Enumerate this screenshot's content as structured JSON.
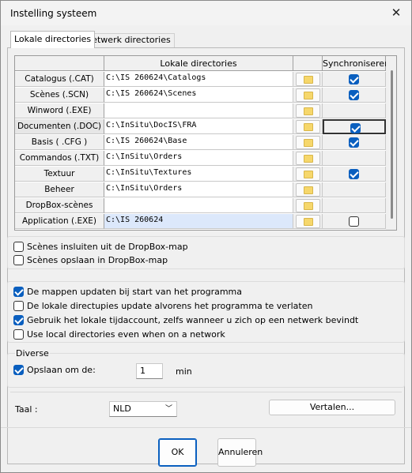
{
  "window": {
    "title": "Instelling systeem",
    "close_glyph": "✕",
    "close_icon": "close-icon"
  },
  "tabs": [
    {
      "label": "Lokale directories",
      "active": true
    },
    {
      "label": "Netwerk directories",
      "active": false
    }
  ],
  "grid": {
    "headers": [
      "",
      "Lokale directories",
      "",
      "Synchroniseren"
    ],
    "rows": [
      {
        "name": "Catalogus (.CAT)",
        "path": "C:\\IS 260624\\Catalogs",
        "folder": true,
        "sync": "checked"
      },
      {
        "name": "Scènes (.SCN)",
        "path": "C:\\IS 260624\\Scenes",
        "folder": true,
        "sync": "checked"
      },
      {
        "name": "Winword (.EXE)",
        "path": "",
        "folder": true,
        "sync": "none"
      },
      {
        "name": "Documenten (.DOC)",
        "path": "C:\\InSitu\\DocIS\\FRA",
        "folder": true,
        "sync": "checked"
      },
      {
        "name": "Basis ( .CFG )",
        "path": "C:\\IS 260624\\Base",
        "folder": true,
        "sync": "checked"
      },
      {
        "name": "Commandos (.TXT)",
        "path": "C:\\InSitu\\Orders",
        "folder": true,
        "sync": "none"
      },
      {
        "name": "Textuur",
        "path": "C:\\InSitu\\Textures",
        "folder": true,
        "sync": "checked"
      },
      {
        "name": "Beheer",
        "path": "C:\\InSitu\\Orders",
        "folder": true,
        "sync": "none"
      },
      {
        "name": "DropBox-scènes",
        "path": "",
        "folder": true,
        "sync": "none"
      },
      {
        "name": "Application (.EXE)",
        "path": "C:\\IS 260624",
        "folder": true,
        "sync": "unchecked"
      }
    ]
  },
  "dropbox_options": [
    {
      "label": "Scènes insluiten uit de DropBox-map",
      "checked": false
    },
    {
      "label": "Scènes opslaan in DropBox-map",
      "checked": false
    }
  ],
  "general_options": [
    {
      "label": "De mappen updaten bij start van het programma",
      "checked": true
    },
    {
      "label": "De lokale directupies update alvorens het programma te verlaten",
      "checked": false
    },
    {
      "label": "Gebruik het lokale tijdaccount, zelfs wanneer u zich op een netwerk bevindt",
      "checked": true
    },
    {
      "label": "Use local directories even when on a network",
      "checked": false
    }
  ],
  "diverse": {
    "legend": "Diverse",
    "save_label": "Opslaan om de:",
    "save_checked": true,
    "save_value": "1",
    "save_unit": "min"
  },
  "language": {
    "label": "Taal :",
    "value": "NLD",
    "chevron": "﹀",
    "translate_button": "Vertalen..."
  },
  "buttons": {
    "ok": "OK",
    "cancel": "Annuleren"
  },
  "colors": {
    "accent": "#0a5fbf",
    "folder": "#f6d76b",
    "highlight": "#dce8fb"
  }
}
